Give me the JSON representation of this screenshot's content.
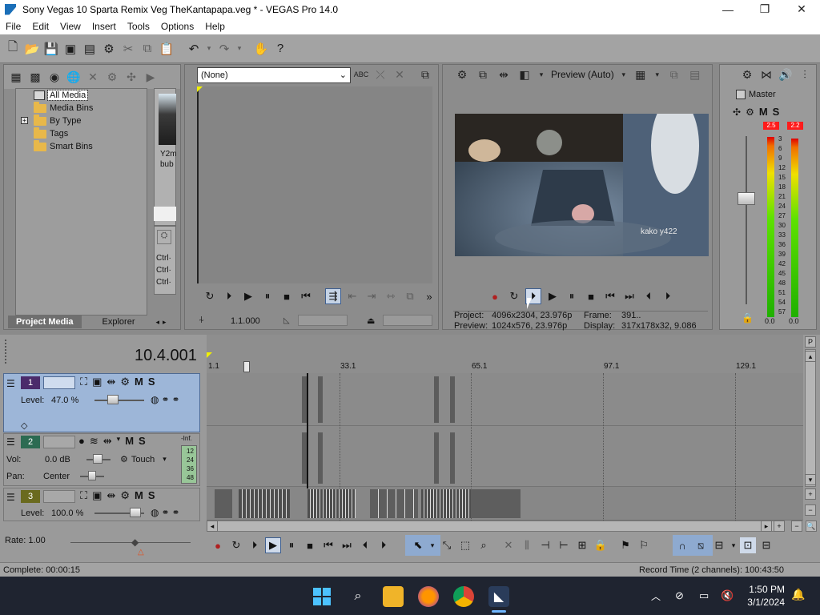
{
  "window": {
    "title": "Sony Vegas 10 Sparta Remix Veg TheKantapapa.veg * - VEGAS Pro 14.0",
    "minimize": "—",
    "maximize": "❐",
    "close": "✕"
  },
  "menu": [
    "File",
    "Edit",
    "View",
    "Insert",
    "Tools",
    "Options",
    "Help"
  ],
  "project_media": {
    "tree": [
      "All Media",
      "Media Bins",
      "By Type",
      "Tags",
      "Smart Bins"
    ],
    "expander": "+",
    "thumb_label_1": "Y2m",
    "thumb_label_2": "bub",
    "ctrl_labels": [
      "Ctrl·",
      "Ctrl·",
      "Ctrl·"
    ],
    "tabs": [
      "Project Media",
      "Explorer"
    ]
  },
  "trimmer": {
    "dropdown_value": "(None)",
    "timecode": "1.1.000"
  },
  "preview": {
    "mode_label": "Preview (Auto)",
    "watermark": "kako y422",
    "project_label": "Project:",
    "project_value": "4096x2304, 23.976p",
    "preview_label": "Preview:",
    "preview_value": "1024x576, 23.976p",
    "frame_label": "Frame:",
    "frame_value": "391..",
    "display_label": "Display:",
    "display_value": "317x178x32, 9.086"
  },
  "master": {
    "title": "Master",
    "mute": "M",
    "solo": "S",
    "peak_left": "2.5",
    "peak_right": "2.2",
    "scale": [
      "3",
      "6",
      "9",
      "12",
      "15",
      "18",
      "21",
      "24",
      "27",
      "30",
      "33",
      "36",
      "39",
      "42",
      "45",
      "48",
      "51",
      "54",
      "57"
    ],
    "bottom_left": "0.0",
    "bottom_right": "0.0",
    "level_left": 0.98,
    "level_right": 0.97
  },
  "timeline": {
    "cursor_time": "10.4.001",
    "ruler": [
      "1.1",
      "33.1",
      "65.1",
      "97.1",
      "129.1"
    ],
    "tracks": [
      {
        "number": "1",
        "level_label": "Level:",
        "level_value": "47.0 %",
        "m": "M",
        "s": "S"
      },
      {
        "number": "2",
        "vol_label": "Vol:",
        "vol_value": "0.0 dB",
        "pan_label": "Pan:",
        "pan_value": "Center",
        "touch": "Touch",
        "m": "M",
        "s": "S",
        "meter_inf": "-Inf.",
        "meter_scale": [
          "12",
          "24",
          "36",
          "48"
        ]
      },
      {
        "number": "3",
        "level_label": "Level:",
        "level_value": "100.0 %",
        "m": "M",
        "s": "S"
      }
    ],
    "rate": "Rate: 1.00"
  },
  "status": {
    "left": "Complete: 00:00:15",
    "right": "Record Time (2 channels): 100:43:50"
  },
  "taskbar": {
    "time": "1:50 PM",
    "date": "3/1/2024"
  },
  "colors": {
    "track1_header": "#9db6d8",
    "track1_number_bg": "#4b2b6b",
    "track2_number_bg": "#2c6b52",
    "track3_number_bg": "#6a6a1e"
  }
}
